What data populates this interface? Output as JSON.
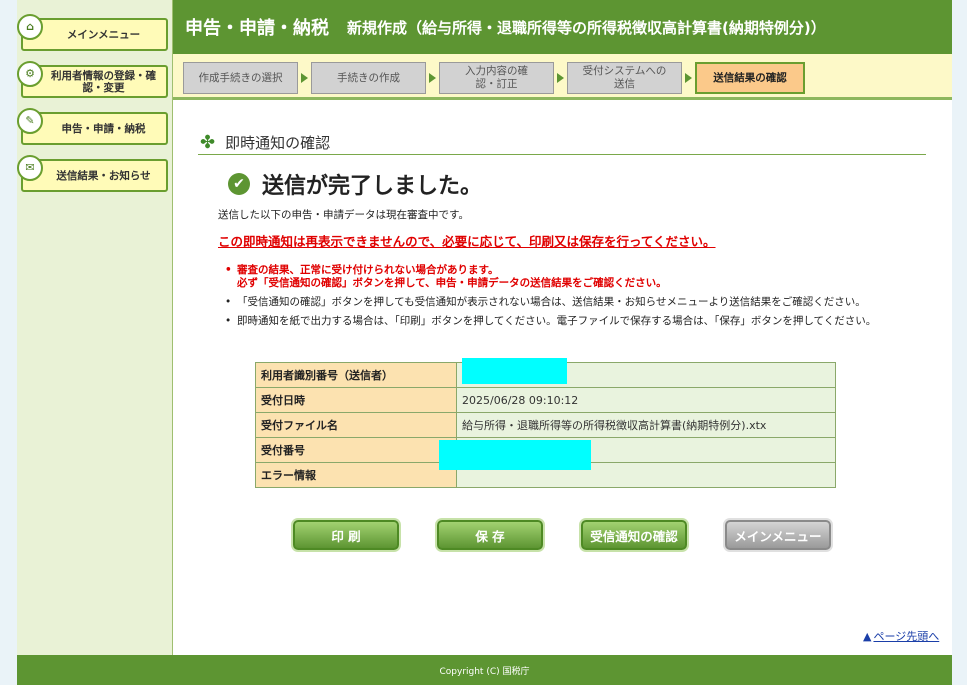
{
  "sidebar": {
    "items": [
      {
        "label": "メインメニュー",
        "icon": "home-icon"
      },
      {
        "label": "利用者情報の登録・確認・変更",
        "icon": "gear-icon"
      },
      {
        "label": "申告・申請・納税",
        "icon": "document-icon"
      },
      {
        "label": "送信結果・お知らせ",
        "icon": "mail-icon"
      }
    ]
  },
  "header": {
    "title": "申告・申請・納税",
    "subtitle": "新規作成（給与所得・退職所得等の所得税徴収高計算書(納期特例分)）"
  },
  "steps": [
    {
      "label": "作成手続きの選択",
      "active": false
    },
    {
      "label": "手続きの作成",
      "active": false
    },
    {
      "label": "入力内容の確認・訂正",
      "active": false
    },
    {
      "label": "受付システムへの送信",
      "active": false
    },
    {
      "label": "送信結果の確認",
      "active": true
    }
  ],
  "section": {
    "title": "即時通知の確認",
    "done": "送信が完了しました。",
    "description": "送信した以下の申告・申請データは現在審査中です。",
    "warning": "この即時通知は再表示できませんので、必要に応じて、印刷又は保存を行ってください。",
    "notes": [
      {
        "line1": "審査の結果、正常に受け付けられない場合があります。",
        "line2": "必ず「受信通知の確認」ボタンを押して、申告・申請データの送信結果をご確認ください。",
        "red": true
      },
      {
        "line1": "「受信通知の確認」ボタンを押しても受信通知が表示されない場合は、送信結果・お知らせメニューより送信結果をご確認ください。",
        "line2": "",
        "red": false
      },
      {
        "line1": "即時通知を紙で出力する場合は、「印刷」ボタンを押してください。電子ファイルで保存する場合は、「保存」ボタンを押してください。",
        "line2": "",
        "red": false
      }
    ]
  },
  "table": {
    "rows": [
      {
        "key": "利用者識別番号（送信者）",
        "value": ""
      },
      {
        "key": "受付日時",
        "value": "2025/06/28 09:10:12"
      },
      {
        "key": "受付ファイル名",
        "value": "給与所得・退職所得等の所得税徴収高計算書(納期特例分).xtx"
      },
      {
        "key": "受付番号",
        "value": ""
      },
      {
        "key": "エラー情報",
        "value": ""
      }
    ]
  },
  "buttons": {
    "print": "印 刷",
    "save": "保 存",
    "confirm": "受信通知の確認",
    "main_menu": "メインメニュー"
  },
  "page_top": "ページ先頭へ",
  "footer": "Copyright (C) 国税庁",
  "colors": {
    "accent": "#5d9532",
    "warning": "#e00000",
    "mask": "#00ffff"
  }
}
